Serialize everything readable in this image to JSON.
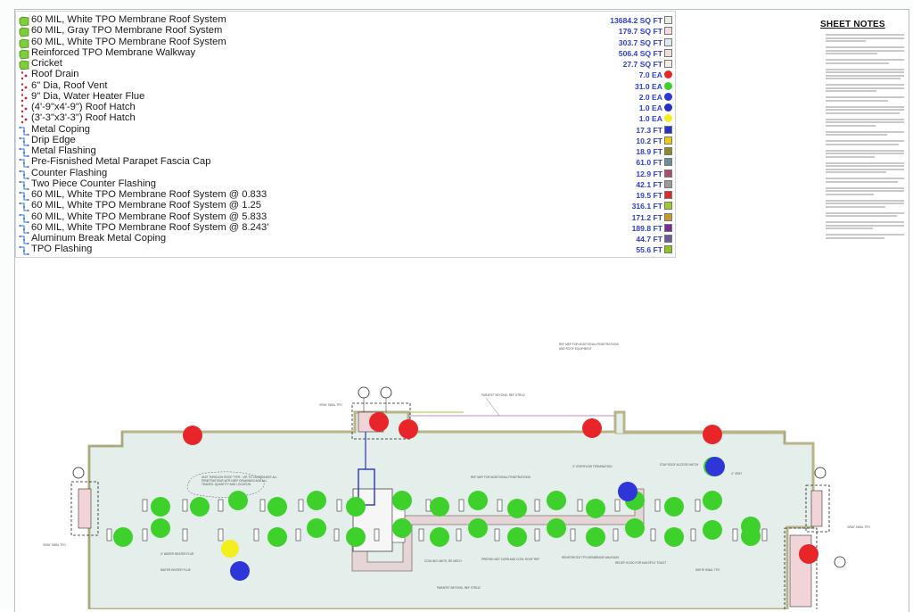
{
  "legend": {
    "items": [
      {
        "name": "60 MIL, White TPO Membrane Roof System",
        "qty": "13684.2 SQ FT",
        "icon": "area-icon",
        "color": "#e3ece6",
        "kind": "area"
      },
      {
        "name": "60 MIL, Gray TPO Membrane Roof System",
        "qty": "179.7 SQ FT",
        "icon": "area-icon",
        "color": "#f6d9dc",
        "kind": "area"
      },
      {
        "name": "60 MIL, White TPO Membrane Roof System",
        "qty": "303.7 SQ FT",
        "icon": "area-icon",
        "color": "#dde9f5",
        "kind": "area"
      },
      {
        "name": "Reinforced TPO Membrane Walkway",
        "qty": "506.4 SQ FT",
        "icon": "area-icon",
        "color": "#f0dede",
        "kind": "area"
      },
      {
        "name": "Cricket",
        "qty": "27.7 SQ FT",
        "icon": "area-icon",
        "color": "#f8ece2",
        "kind": "area"
      },
      {
        "name": "Roof Drain",
        "qty": "7.0 EA",
        "icon": "count-icon",
        "color": "#e8262a",
        "kind": "count"
      },
      {
        "name": "6\" Dia, Roof Vent",
        "qty": "31.0 EA",
        "icon": "count-icon",
        "color": "#3ed12b",
        "kind": "count"
      },
      {
        "name": "9\" Dia, Water Heater Flue",
        "qty": "2.0 EA",
        "icon": "count-icon",
        "color": "#2f36d8",
        "kind": "count"
      },
      {
        "name": "(4'-9\"x4'-9\") Roof Hatch",
        "qty": "1.0 EA",
        "icon": "count-icon",
        "color": "#2a2ec8",
        "kind": "count"
      },
      {
        "name": "(3'-3\"x3'-3\") Roof Hatch",
        "qty": "1.0 EA",
        "icon": "count-icon",
        "color": "#f4ee1c",
        "kind": "count"
      },
      {
        "name": "Metal Coping",
        "qty": "17.3 FT",
        "icon": "linear-icon",
        "color": "#2634c9",
        "kind": "linear"
      },
      {
        "name": "Drip Edge",
        "qty": "10.2 FT",
        "icon": "linear-icon",
        "color": "#f2c80e",
        "kind": "linear"
      },
      {
        "name": "Metal Flashing",
        "qty": "18.9 FT",
        "icon": "linear-icon",
        "color": "#8e8a24",
        "kind": "linear"
      },
      {
        "name": "Pre-Fisnished Metal Parapet Fascia Cap",
        "qty": "61.0 FT",
        "icon": "linear-icon",
        "color": "#6b8f9a",
        "kind": "linear"
      },
      {
        "name": "Counter Flashing",
        "qty": "12.9 FT",
        "icon": "linear-icon",
        "color": "#b04a6d",
        "kind": "linear"
      },
      {
        "name": "Two Piece Counter Flashing",
        "qty": "42.1 FT",
        "icon": "linear-icon",
        "color": "#9a9a9a",
        "kind": "linear"
      },
      {
        "name": "60 MIL, White TPO Membrane Roof System @ 0.833",
        "qty": "19.5 FT",
        "icon": "linear-icon",
        "color": "#e02a2a",
        "kind": "linear"
      },
      {
        "name": "60 MIL, White TPO Membrane Roof System @ 1.25",
        "qty": "316.1 FT",
        "icon": "linear-icon",
        "color": "#9ccc2a",
        "kind": "linear"
      },
      {
        "name": "60 MIL, White TPO Membrane Roof System @ 5.833",
        "qty": "171.2 FT",
        "icon": "linear-icon",
        "color": "#c79a2a",
        "kind": "linear"
      },
      {
        "name": "60 MIL, White TPO Membrane Roof System @ 8.243'",
        "qty": "189.8 FT",
        "icon": "linear-icon",
        "color": "#7a2a9a",
        "kind": "linear"
      },
      {
        "name": "Aluminum Break Metal Coping",
        "qty": "44.7 FT",
        "icon": "linear-icon",
        "color": "#6b5a9a",
        "kind": "linear"
      },
      {
        "name": "TPO Flashing",
        "qty": "55.6 FT",
        "icon": "linear-icon",
        "color": "#8ec41e",
        "kind": "linear"
      }
    ]
  },
  "notes": {
    "title": "SHEET NOTES"
  },
  "plan": {
    "colors": {
      "roof_fill": "#e4eeea",
      "parapet": "#b9b58a",
      "walkway": "#e4d6d6",
      "gray_tpo": "#f1d4d7",
      "drain": "#e8262a",
      "vent": "#3ed12b",
      "flue": "#2f36d8",
      "hatch": "#f4ee1c"
    }
  }
}
